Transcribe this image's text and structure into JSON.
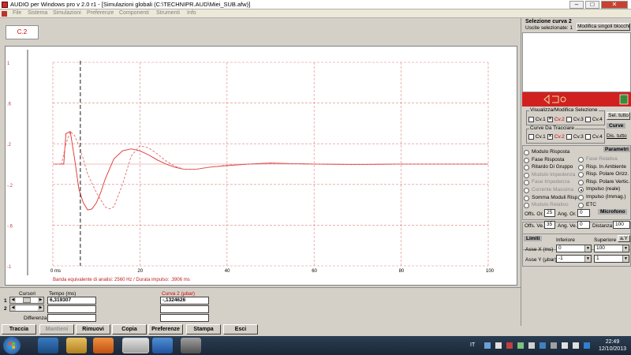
{
  "window": {
    "title": "AUDIO per Windows pro v 2.0 r1 - [Simulazioni globali (C:\\TECHNIPR.AUD\\Miei_SUB.afw)]"
  },
  "menu": [
    "File",
    "Sistema",
    "Simulazioni",
    "Preferenze",
    "Componenti",
    "Strumenti",
    "Info"
  ],
  "curve_button": "C.2",
  "chart_data": {
    "type": "line",
    "title": "",
    "xlabel": "",
    "ylabel": "",
    "xlim": [
      0,
      100
    ],
    "ylim": [
      -1,
      1
    ],
    "x_ticks": [
      "0 ms",
      "20",
      "40",
      "60",
      "80",
      "100"
    ],
    "y_ticks": [
      "1",
      ".6",
      ".2",
      "-.2",
      "-.6",
      "-1"
    ],
    "grid": true,
    "cursor_x": 6.319307,
    "annotation": "Banda equivalente di analisi: 2560 Hz / Durata impulso: .3906 ms",
    "series": [
      {
        "color": "#e03030",
        "style": "solid",
        "x": [
          0,
          2.5,
          3,
          4,
          5,
          6,
          7,
          8,
          9,
          10,
          11,
          12,
          14,
          16,
          18,
          20,
          22,
          24,
          26,
          28,
          30,
          33,
          36,
          40,
          45,
          50,
          55,
          60,
          70,
          80,
          100
        ],
        "y": [
          0,
          0,
          0.3,
          0.32,
          0.05,
          -0.25,
          -0.38,
          -0.45,
          -0.44,
          -0.38,
          -0.28,
          -0.15,
          0.05,
          0.13,
          0.15,
          0.13,
          0.09,
          0.04,
          0.0,
          -0.03,
          -0.05,
          -0.05,
          -0.03,
          -0.015,
          0.0,
          0.01,
          0.005,
          0.0,
          -0.005,
          0.0,
          0.0
        ]
      },
      {
        "color": "#e07070",
        "style": "dashed",
        "x": [
          0,
          2,
          3,
          4,
          5,
          6,
          7,
          8,
          10,
          12,
          13,
          14,
          16,
          18,
          20,
          22,
          24,
          26,
          28,
          30,
          33,
          36,
          40,
          45,
          50,
          55,
          60,
          70,
          80,
          100
        ],
        "y": [
          0,
          0,
          0.2,
          0.32,
          0.28,
          0.18,
          0.05,
          -0.1,
          -0.28,
          -0.42,
          -0.44,
          -0.42,
          -0.2,
          0.08,
          0.18,
          0.16,
          0.1,
          0.03,
          -0.02,
          -0.05,
          -0.05,
          -0.03,
          -0.01,
          0.0,
          0.005,
          0.005,
          0.0,
          -0.005,
          0.0,
          0.0
        ]
      }
    ]
  },
  "right_panel": {
    "header": "Selezione curva 2",
    "outputs_selected": "Uscite selezionate: 1",
    "edit_blocks_button": "Modifica singoli blocchi",
    "view_edit_label": "Visualizza/Modifica Selezione",
    "view_curves": [
      {
        "label": "Cv.1",
        "checked": false
      },
      {
        "label": "Cv.2",
        "checked": true
      },
      {
        "label": "Cv.3",
        "checked": false
      },
      {
        "label": "Cv.4",
        "checked": false
      }
    ],
    "select_all_button": "Sel. tutto",
    "curves_label": "Curve",
    "trace_label": "Curve Da Tracciare",
    "trace_curves": [
      {
        "label": "Cv.1",
        "checked": false
      },
      {
        "label": "Cv.2",
        "checked": true
      },
      {
        "label": "Cv.3",
        "checked": false
      },
      {
        "label": "Cv.4",
        "checked": false
      }
    ],
    "deselect_all_button": "Dis. tutto",
    "params_label": "Parametri",
    "params_left": [
      {
        "label": "Modulo Risposta",
        "enabled": true,
        "selected": false
      },
      {
        "label": "Fase Risposta",
        "enabled": true,
        "selected": false
      },
      {
        "label": "Ritardo Di Gruppo",
        "enabled": true,
        "selected": false
      },
      {
        "label": "Modulo Impedenza",
        "enabled": false,
        "selected": false
      },
      {
        "label": "Fase Impedenza",
        "enabled": false,
        "selected": false
      },
      {
        "label": "Corrente Massima",
        "enabled": false,
        "selected": false
      },
      {
        "label": "Somma Moduli Risp.",
        "enabled": true,
        "selected": false
      },
      {
        "label": "Modulo Relativo",
        "enabled": false,
        "selected": false
      }
    ],
    "params_right": [
      {
        "label": "Fase Relativa",
        "enabled": false,
        "selected": false
      },
      {
        "label": "Risp. In Ambiente",
        "enabled": true,
        "selected": false
      },
      {
        "label": "Risp. Polare Orizz.",
        "enabled": true,
        "selected": false
      },
      {
        "label": "Risp. Polare Vertic.",
        "enabled": true,
        "selected": false
      },
      {
        "label": "Impulso (reale)",
        "enabled": true,
        "selected": true
      },
      {
        "label": "Impulso (Immag.)",
        "enabled": true,
        "selected": false
      },
      {
        "label": "ETC",
        "enabled": true,
        "selected": false
      }
    ],
    "mic": {
      "label": "Microfono",
      "offs_or_label": "Offs. Or.",
      "offs_or_value": "25",
      "ang_or_label": "Ang. Or.",
      "ang_or_value": "0",
      "offs_ve_label": "Offs. Ve.",
      "offs_ve_value": "35",
      "ang_ve_label": "Ang. Ve.",
      "ang_ve_value": "0",
      "dist_label": "Distanza",
      "dist_value": "100"
    },
    "limits": {
      "label": "Limiti",
      "lower_label": "Inferiore",
      "upper_label": "Superiore",
      "ay_button": "a.Y",
      "x_axis_label": "Asse X  (ms)",
      "x_lower": "0",
      "x_upper": "100",
      "y_axis_label": "Asse Y  (µbar)",
      "y_lower": "-1",
      "y_upper": "1"
    }
  },
  "cursor_panel": {
    "cursor_label": "Cursori",
    "time_label": "Tempo (ms)",
    "curve_label": "Curva 2 (µbar)",
    "row1_index": "1",
    "row2_index": "2",
    "time_value": "6,319307",
    "curve_value": "-,1324626",
    "difference_label": "Differenza"
  },
  "toolbar": [
    "Traccia",
    "Mantieni",
    "Rimuovi",
    "Copia",
    "Preferenze",
    "Stampa",
    "Esci"
  ],
  "taskbar": {
    "lang": "IT",
    "time": "22:49",
    "date": "12/10/2013"
  }
}
